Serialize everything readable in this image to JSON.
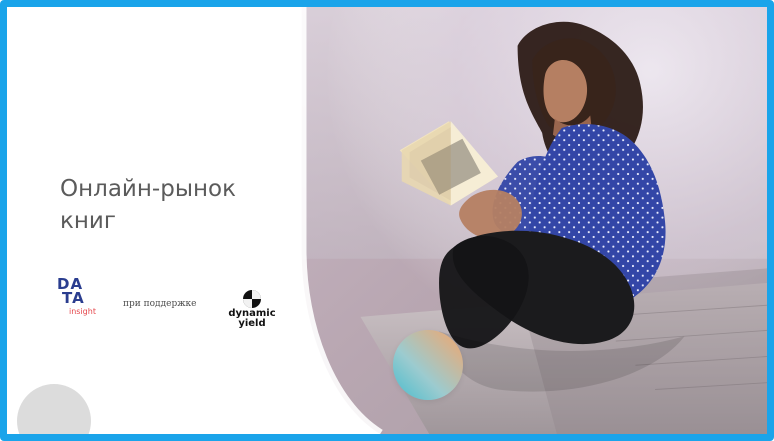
{
  "slide": {
    "title": "Онлайн-рынок\nкниг",
    "logos": {
      "data_insight": {
        "row1": "DA",
        "row2": "TA",
        "sub": "insight"
      },
      "support_text": "при поддержке",
      "dynamic_yield": "dynamic\nyield"
    }
  },
  "colors": {
    "frame_border": "#1aa4ea",
    "title_text": "#5b5b5b",
    "data_blue": "#2a3d8f",
    "data_red": "#e5484d"
  }
}
